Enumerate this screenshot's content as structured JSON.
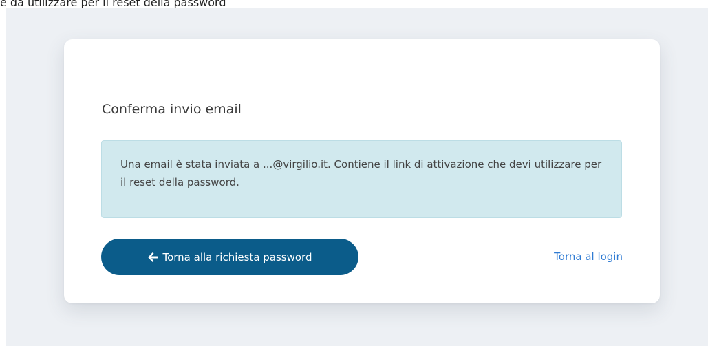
{
  "page": {
    "top_text": "e da utilizzare per il reset della password"
  },
  "card": {
    "title": "Conferma invio email",
    "alert_text": "Una email è stata inviata a ...@virgilio.it. Contiene il link di attivazione che devi utilizzare per il reset della password.",
    "back_button_label": "Torna alla richiesta password",
    "back_button_icon": "arrow-left-icon",
    "login_link_label": "Torna al login"
  },
  "colors": {
    "backdrop": "#edf0f4",
    "card_background": "#ffffff",
    "alert_background": "#d1e9ee",
    "alert_border": "#bcdde5",
    "button_primary": "#0b5c8a",
    "link": "#2f7bd3"
  }
}
